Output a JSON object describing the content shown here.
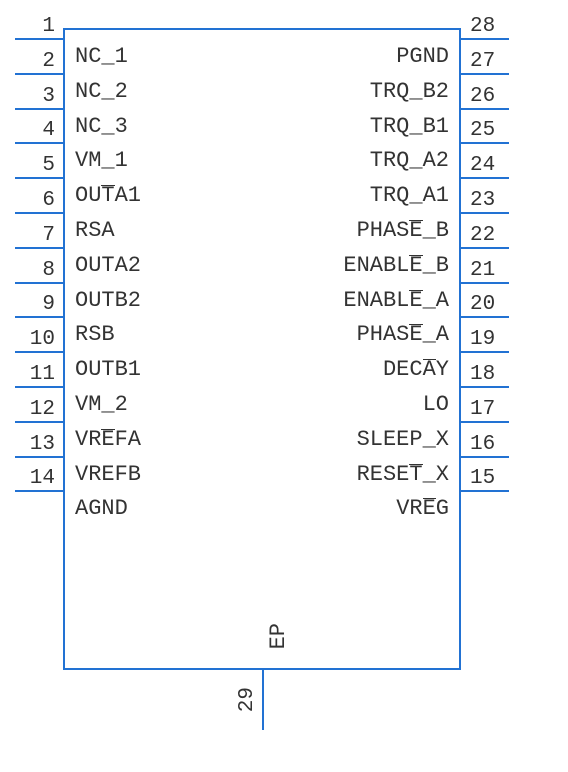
{
  "chip": {
    "left_pins": [
      {
        "num": "1",
        "label": "NC_1",
        "overline_pos": null
      },
      {
        "num": "2",
        "label": "NC_2",
        "overline_pos": null
      },
      {
        "num": "3",
        "label": "NC_3",
        "overline_pos": null
      },
      {
        "num": "4",
        "label": "VM_1",
        "overline_pos": null
      },
      {
        "num": "5",
        "label": "OUTA1",
        "overline_char": "T",
        "parts": [
          "OU",
          "T",
          "A1"
        ]
      },
      {
        "num": "6",
        "label": "RSA",
        "overline_pos": null
      },
      {
        "num": "7",
        "label": "OUTA2",
        "overline_pos": null
      },
      {
        "num": "8",
        "label": "OUTB2",
        "overline_pos": null
      },
      {
        "num": "9",
        "label": "RSB",
        "overline_pos": null
      },
      {
        "num": "10",
        "label": "OUTB1",
        "overline_pos": null
      },
      {
        "num": "11",
        "label": "VM_2",
        "overline_pos": null
      },
      {
        "num": "12",
        "label": "VREFA",
        "overline_char": "E",
        "parts": [
          "VR",
          "E",
          "FA"
        ]
      },
      {
        "num": "13",
        "label": "VREFB",
        "overline_pos": null
      },
      {
        "num": "14",
        "label": "AGND",
        "overline_pos": null
      }
    ],
    "right_pins": [
      {
        "num": "28",
        "label": "PGND",
        "overline_pos": null
      },
      {
        "num": "27",
        "label": "TRQ_B2",
        "overline_pos": null
      },
      {
        "num": "26",
        "label": "TRQ_B1",
        "overline_pos": null
      },
      {
        "num": "25",
        "label": "TRQ_A2",
        "overline_pos": null
      },
      {
        "num": "24",
        "label": "TRQ_A1",
        "overline_pos": null
      },
      {
        "num": "23",
        "label": "PHASE_B",
        "overline_char": "E",
        "parts": [
          "PHAS",
          "E",
          "_B"
        ]
      },
      {
        "num": "22",
        "label": "ENABLE_B",
        "overline_char": "E",
        "parts": [
          "ENABL",
          "E",
          "_B"
        ]
      },
      {
        "num": "21",
        "label": "ENABLE_A",
        "overline_char": "E",
        "parts": [
          "ENABL",
          "E",
          "_A"
        ]
      },
      {
        "num": "20",
        "label": "PHASE_A",
        "overline_char": "E",
        "parts": [
          "PHAS",
          "E",
          "_A"
        ]
      },
      {
        "num": "19",
        "label": "DECAY",
        "overline_char": "A",
        "parts": [
          "DEC",
          "A",
          "Y"
        ]
      },
      {
        "num": "18",
        "label": "LO",
        "overline_pos": null
      },
      {
        "num": "17",
        "label": "SLEEP_X",
        "overline_pos": null
      },
      {
        "num": "16",
        "label": "RESET_X",
        "overline_char": "T",
        "parts": [
          "RESE",
          "T",
          "_X"
        ]
      },
      {
        "num": "15",
        "label": "VREG",
        "overline_char": "E",
        "parts": [
          "VR",
          "E",
          "G"
        ]
      }
    ],
    "bottom_pin": {
      "num": "29",
      "label": "EP"
    }
  }
}
